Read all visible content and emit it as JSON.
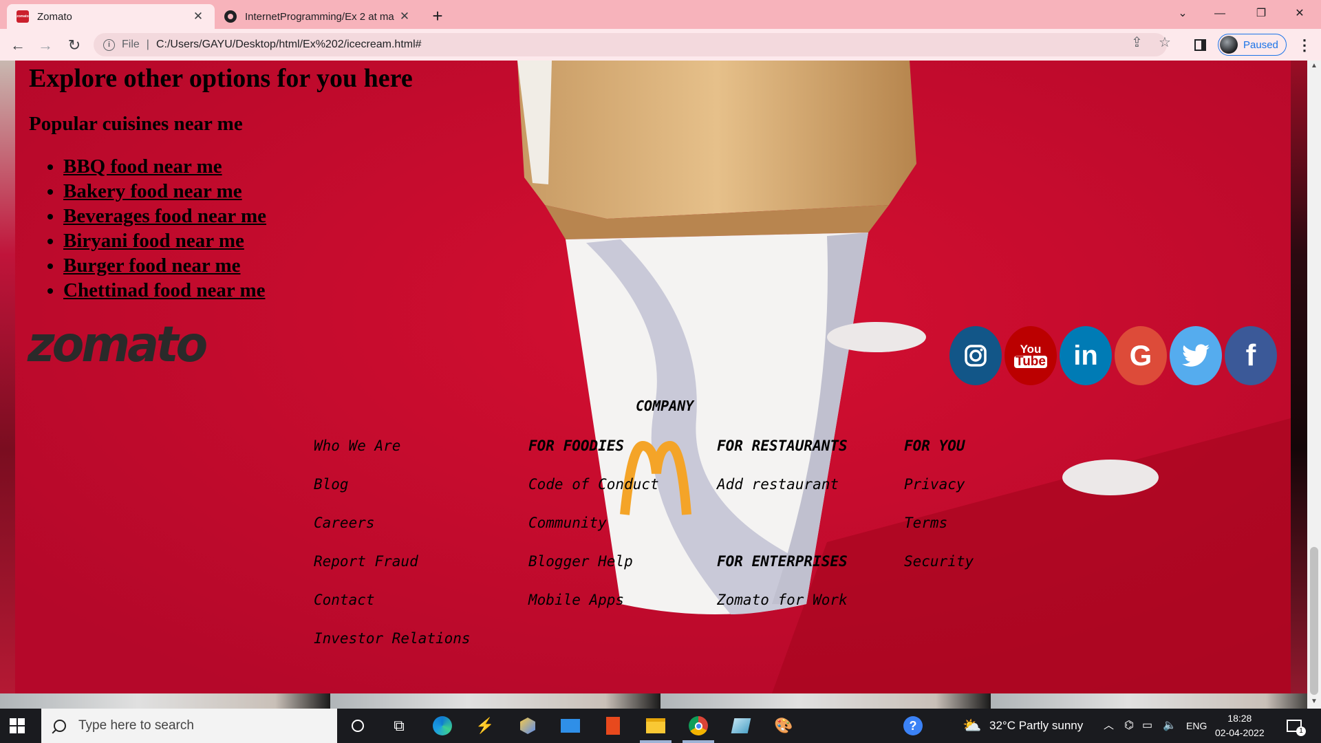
{
  "browser": {
    "tabs": [
      {
        "title": "Zomato",
        "favicon": "zomato-favicon",
        "active": true
      },
      {
        "title": "InternetProgramming/Ex 2 at ma",
        "favicon": "github-favicon",
        "active": false
      }
    ],
    "close_glyph": "✕",
    "new_tab_glyph": "+",
    "url_scheme_label": "File",
    "url": "C:/Users/GAYU/Desktop/html/Ex%202/icecream.html#",
    "profile_label": "Paused",
    "accent": "#1a73e8",
    "tabstrip_color": "#f7b3bb"
  },
  "page": {
    "heading": "Explore other options for you here",
    "subheading": "Popular cuisines near me",
    "cuisines": [
      "BBQ food near me",
      "Bakery food near me",
      "Beverages food near me",
      "Biryani food near me",
      "Burger food near me",
      "Chettinad food near me"
    ],
    "logo_text": "zomato",
    "background_color": "#c40a2c",
    "socials": [
      {
        "name": "instagram",
        "color": "#125688"
      },
      {
        "name": "youtube",
        "color": "#bb0000",
        "label_top": "You",
        "label_bottom": "Tube"
      },
      {
        "name": "linkedin",
        "color": "#007bb5",
        "label": "in"
      },
      {
        "name": "google",
        "color": "#dd4b39",
        "label": "G"
      },
      {
        "name": "twitter",
        "color": "#55acee"
      },
      {
        "name": "facebook",
        "color": "#3b5998",
        "label": "f"
      }
    ],
    "footer": {
      "heading": "COMPANY",
      "col1": [
        "Who We Are",
        "Blog",
        "Careers",
        "Report Fraud",
        "Contact",
        "Investor Relations"
      ],
      "col2": [
        "FOR FOODIES",
        "Code of Conduct",
        "Community",
        "Blogger Help",
        "Mobile Apps"
      ],
      "col3": {
        "header1": "FOR RESTAURANTS",
        "item1": "Add restaurant",
        "header2": "FOR ENTERPRISES",
        "item2": "Zomato for Work"
      },
      "col4": [
        "FOR YOU",
        "Privacy",
        "Terms",
        "Security"
      ]
    }
  },
  "taskbar": {
    "search_placeholder": "Type here to search",
    "weather": "32°C  Partly sunny",
    "language": "ENG",
    "time": "18:28",
    "date": "02-04-2022",
    "notification_count": "1"
  }
}
